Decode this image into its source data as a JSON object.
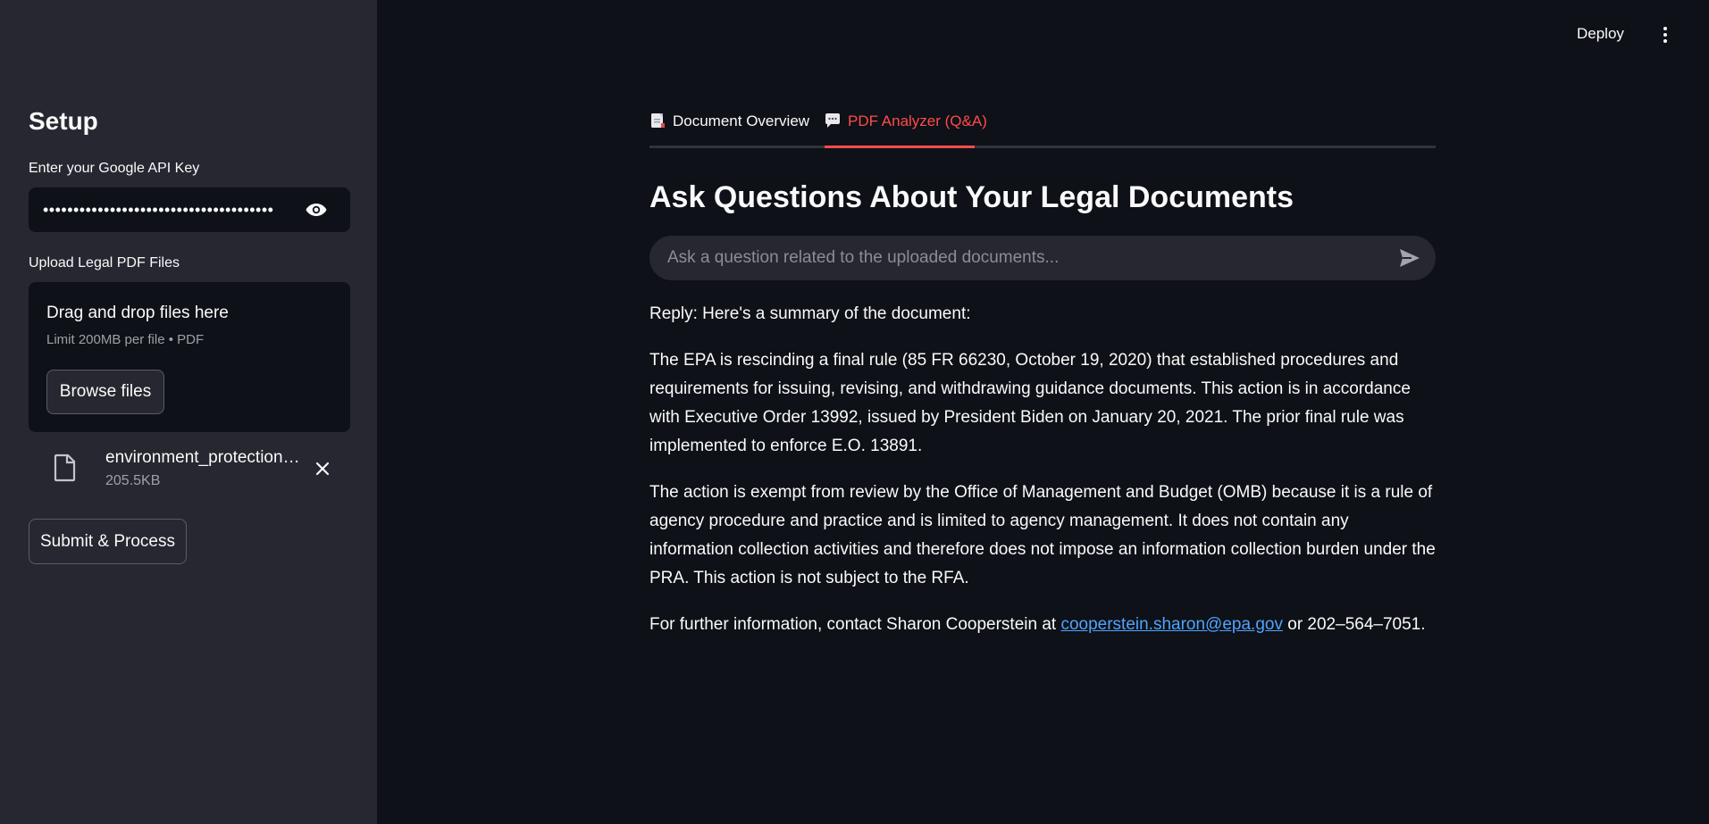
{
  "header": {
    "deploy_label": "Deploy",
    "menu_icon": "kebab-menu-icon"
  },
  "sidebar": {
    "title": "Setup",
    "api_key": {
      "label": "Enter your Google API Key",
      "value": "••••••••••••••••••••••••••••••••••••••",
      "icon": "eye-icon"
    },
    "upload": {
      "label": "Upload Legal PDF Files",
      "dropzone_title": "Drag and drop files here",
      "dropzone_sub": "Limit 200MB per file • PDF",
      "browse_label": "Browse files"
    },
    "file": {
      "name": "environment_protection_agency.pdf",
      "size": "205.5KB",
      "icon": "file-icon"
    },
    "submit_label": "Submit & Process"
  },
  "main": {
    "tabs": [
      {
        "label": "Document Overview",
        "icon": "document-icon"
      },
      {
        "label": "PDF Analyzer (Q&A)",
        "icon": "speech-balloon-icon",
        "active": true
      }
    ],
    "heading": "Ask Questions About Your Legal Documents",
    "chat_placeholder": "Ask a question related to the uploaded documents...",
    "reply": {
      "p1": "Reply: Here's a summary of the document:",
      "p2": "The EPA is rescinding a final rule (85 FR 66230, October 19, 2020) that established procedures and requirements for issuing, revising, and withdrawing guidance documents. This action is in accordance with Executive Order 13992, issued by President Biden on January 20, 2021. The prior final rule was implemented to enforce E.O. 13891.",
      "p3": "The action is exempt from review by the Office of Management and Budget (OMB) because it is a rule of agency procedure and practice and is limited to agency management. It does not contain any information collection activities and therefore does not impose an information collection burden under the PRA. This action is not subject to the RFA.",
      "p4_before": "For further information, contact Sharon Cooperstein at ",
      "p4_link": "cooperstein.sharon@epa.gov",
      "p4_after": " or 202–564–7051."
    }
  },
  "colors": {
    "background": "#0e1117",
    "sidebar": "#262730",
    "accent": "#ff4b4b",
    "link": "#4ea4ff"
  }
}
